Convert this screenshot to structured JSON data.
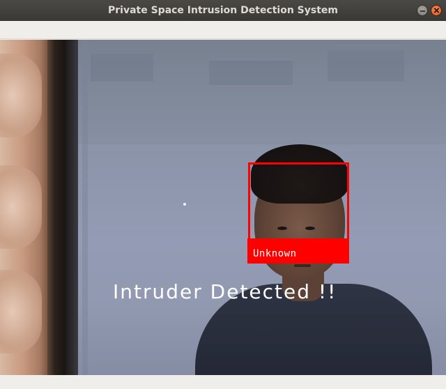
{
  "window": {
    "title": "Private Space Intrusion Detection System"
  },
  "detection": {
    "label": "Unknown",
    "box_color": "#ff0000"
  },
  "alert": {
    "message": "Intruder Detected !!"
  }
}
